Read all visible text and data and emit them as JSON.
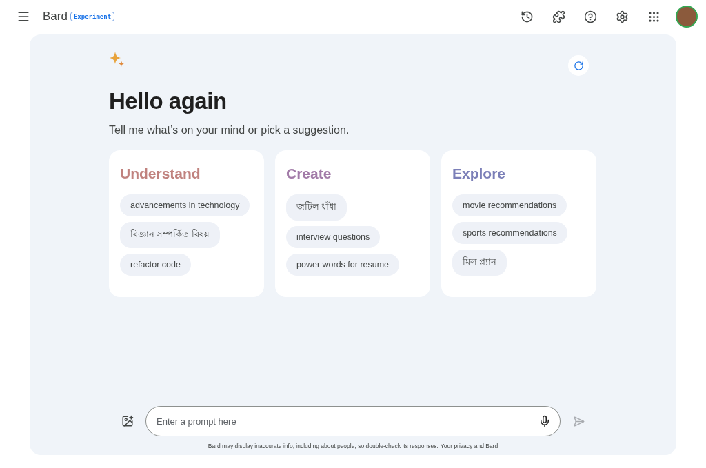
{
  "header": {
    "product": "Bard",
    "badge": "Experiment"
  },
  "greeting": {
    "title": "Hello again",
    "subtitle": "Tell me what’s on your mind or pick a suggestion."
  },
  "cards": [
    {
      "title": "Understand",
      "color": "#c0827e",
      "suggestions": [
        "advancements in technology",
        "বিজ্ঞান সম্পর্কিত বিষয়",
        "refactor code"
      ]
    },
    {
      "title": "Create",
      "color": "#a27ba8",
      "suggestions": [
        "জটিল ধাঁধা",
        "interview questions",
        "power words for resume"
      ]
    },
    {
      "title": "Explore",
      "color": "#7b7fb8",
      "suggestions": [
        "movie recommendations",
        "sports recommendations",
        "মিল প্ল্যান"
      ]
    }
  ],
  "prompt": {
    "placeholder": "Enter a prompt here"
  },
  "footer": {
    "disclaimer": "Bard may display inaccurate info, including about people, so double-check its responses.",
    "link": "Your privacy and Bard"
  }
}
